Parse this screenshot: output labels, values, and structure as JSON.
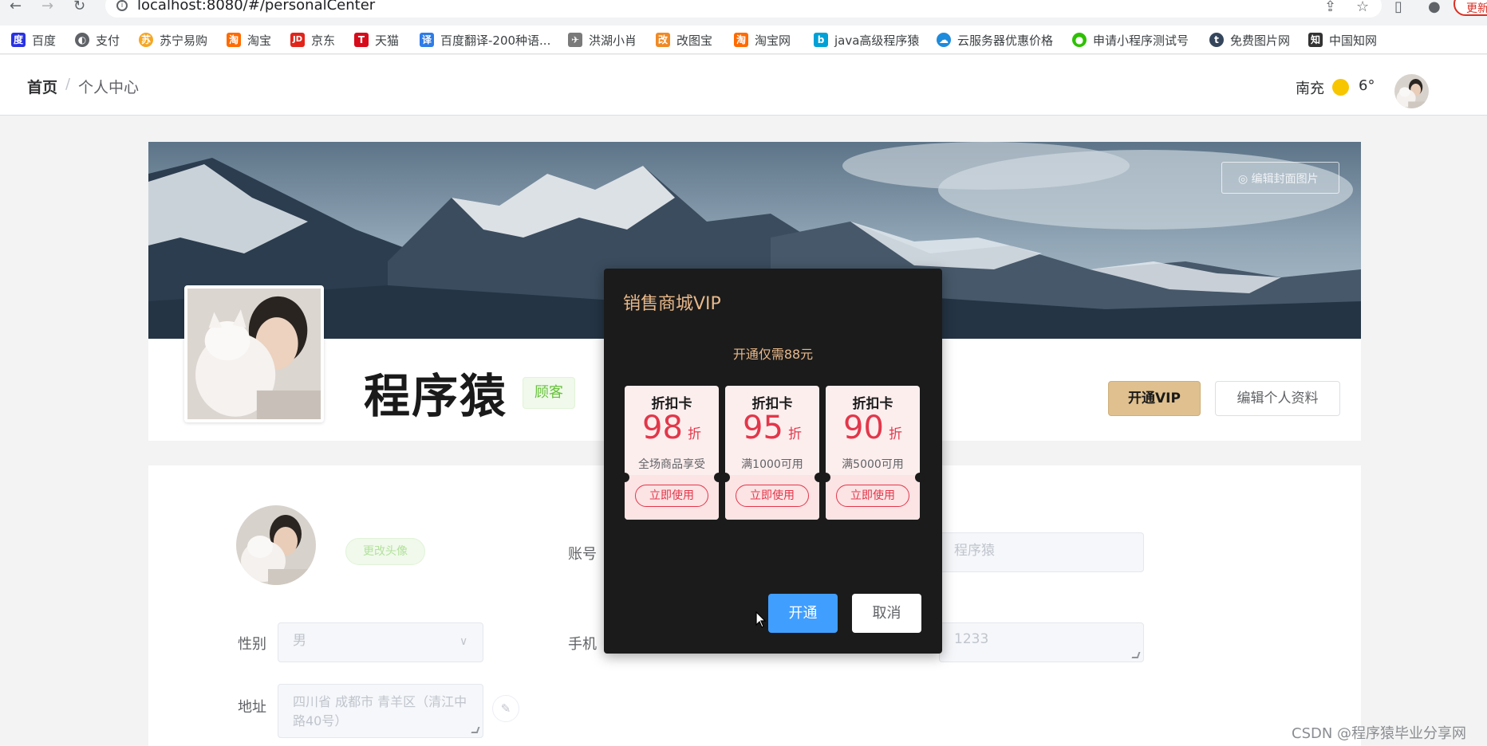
{
  "browser": {
    "url": "localhost:8080/#/personalCenter",
    "update_label": "更新",
    "bookmarks": [
      {
        "label": "百度",
        "icon": "baidu-icon",
        "color": "#2932e1"
      },
      {
        "label": "支付",
        "icon": "globe-icon",
        "color": "#5f6368"
      },
      {
        "label": "苏宁易购",
        "icon": "suning-icon",
        "color": "#f5a623"
      },
      {
        "label": "淘宝",
        "icon": "taobao-icon",
        "color": "#ff6a00"
      },
      {
        "label": "京东",
        "icon": "jd-icon",
        "color": "#e1251b"
      },
      {
        "label": "天猫",
        "icon": "tmall-icon",
        "color": "#d70b1b"
      },
      {
        "label": "百度翻译-200种语...",
        "icon": "translate-icon",
        "color": "#2e7ce7"
      },
      {
        "label": "洪湖小肖",
        "icon": "bird-icon",
        "color": "#7a7a7a"
      },
      {
        "label": "改图宝",
        "icon": "gaitubao-icon",
        "color": "#f08a24"
      },
      {
        "label": "淘宝网",
        "icon": "taobao-net-icon",
        "color": "#ff6a00"
      },
      {
        "label": "java高级程序猿",
        "icon": "bilibili-icon",
        "color": "#00a1d6"
      },
      {
        "label": "云服务器优惠价格",
        "icon": "cloud-icon",
        "color": "#1e8bdc"
      },
      {
        "label": "申请小程序测试号",
        "icon": "wechat-icon",
        "color": "#2dc100"
      },
      {
        "label": "免费图片网",
        "icon": "tumblr-icon",
        "color": "#35465c"
      },
      {
        "label": "中国知网",
        "icon": "cnki-icon",
        "color": "#333333"
      }
    ]
  },
  "header": {
    "breadcrumb_home": "首页",
    "breadcrumb_sep": "/",
    "breadcrumb_current": "个人中心",
    "weather_city": "南充",
    "weather_temp": "6°"
  },
  "profile": {
    "edit_cover_label": "编辑封面图片",
    "name": "程序猿",
    "role": "顾客",
    "vip_button": "开通VIP",
    "edit_profile_button": "编辑个人资料"
  },
  "form": {
    "change_avatar": "更改头像",
    "account_label": "账号",
    "nickname_value": "程序猿",
    "gender_label": "性别",
    "gender_value": "男",
    "phone_label": "手机",
    "textarea_value": "1233",
    "address_label": "地址",
    "address_value": "四川省 成都市 青羊区（清江中路40号）"
  },
  "dialog": {
    "title": "销售商城VIP",
    "subtitle": "开通仅需88元",
    "coupons": [
      {
        "title": "折扣卡",
        "rate": "98",
        "unit": "折",
        "condition": "全场商品享受",
        "action": "立即使用"
      },
      {
        "title": "折扣卡",
        "rate": "95",
        "unit": "折",
        "condition": "满1000可用",
        "action": "立即使用"
      },
      {
        "title": "折扣卡",
        "rate": "90",
        "unit": "折",
        "condition": "满5000可用",
        "action": "立即使用"
      }
    ],
    "confirm_label": "开通",
    "cancel_label": "取消"
  },
  "watermark": "CSDN @程序猿毕业分享网",
  "colors": {
    "vip_gold": "#dfc08e",
    "dialog_bg": "#1b1b1b",
    "dialog_accent": "#e8b88a",
    "coupon_red": "#e2374a",
    "primary_blue": "#409eff",
    "success_green": "#67c23a"
  }
}
